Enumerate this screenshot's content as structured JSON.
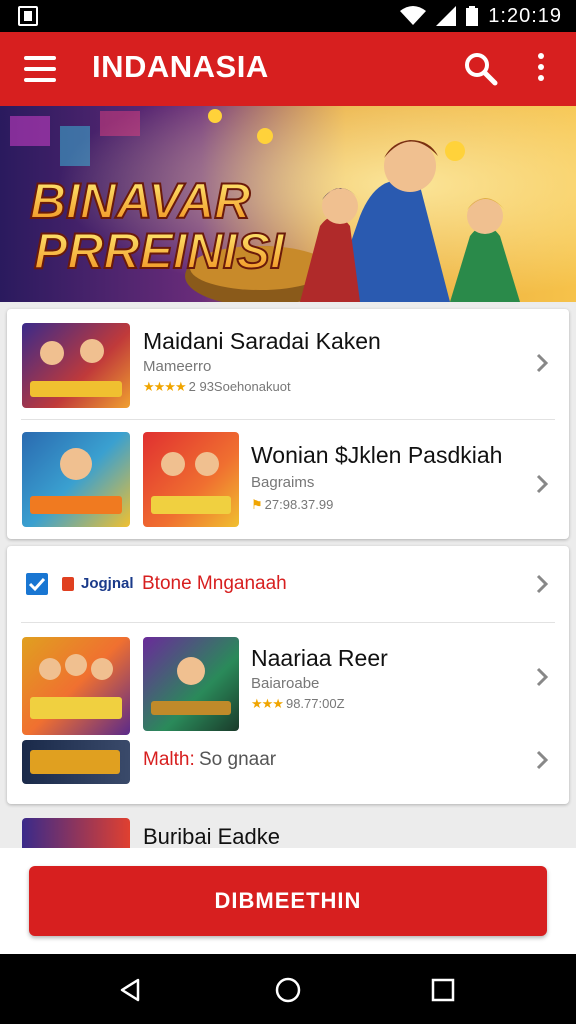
{
  "status_bar": {
    "time": "1:20:19"
  },
  "app_bar": {
    "title": "INDANASIA"
  },
  "banner": {
    "line1": "BINAVAR",
    "line2": "PRREINISI"
  },
  "card1": {
    "items": [
      {
        "title": "Maidani Saradai Kaken",
        "subtitle": "Mameerro",
        "meta": "2 93Soehonakuot",
        "stars": "★★★★"
      },
      {
        "title": "Wonian $Jklen Pasdkiah",
        "subtitle": "Bagraims",
        "meta": "27:98.37.99"
      }
    ]
  },
  "card2": {
    "header": {
      "tag": "Jogjnal",
      "link": "Btone Mnganaah"
    },
    "items": [
      {
        "title": "Naariaa Reer",
        "subtitle": "Baiaroabe",
        "meta": "98.77:00Z",
        "stars": "★★★"
      },
      {
        "accent": "Malth:",
        "label": "So gnaar"
      }
    ]
  },
  "partial_item": {
    "title": "Buribai Eadke"
  },
  "cta": {
    "label": "DIBMEETHIN"
  },
  "colors": {
    "brand_red": "#d71f1f",
    "star": "#f0a500",
    "checkbox_blue": "#1976d2"
  },
  "icons": [
    "menu-icon",
    "search-icon",
    "more-icon",
    "chevron-right-icon",
    "checkbox-icon",
    "back-icon",
    "home-icon",
    "recents-icon"
  ]
}
